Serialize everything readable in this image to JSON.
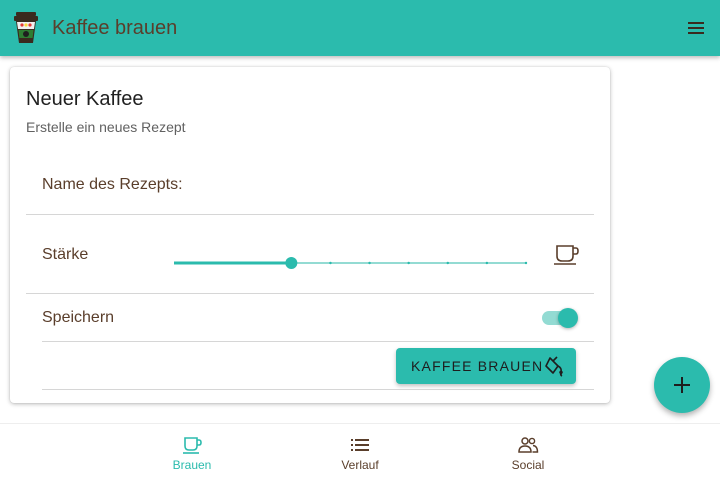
{
  "header": {
    "title": "Kaffee brauen",
    "logo_icon": "coffee-cup-logo-icon",
    "menu_icon": "menu-icon"
  },
  "card": {
    "title": "Neuer Kaffee",
    "subtitle": "Erstelle ein neues Rezept",
    "name_field": {
      "label": "Name des Rezepts:",
      "value": ""
    },
    "strength": {
      "label": "Stärke",
      "value": 4,
      "min": 1,
      "max": 10,
      "icon": "coffee-cup-icon"
    },
    "save": {
      "label": "Speichern",
      "enabled": true
    },
    "brew_button": {
      "label": "KAFFEE BRAUEN",
      "icon": "coffee-pour-icon"
    }
  },
  "fab": {
    "icon": "add-icon"
  },
  "bottom_nav": {
    "items": [
      {
        "label": "Brauen",
        "icon": "coffee-cup-icon",
        "active": true
      },
      {
        "label": "Verlauf",
        "icon": "list-icon",
        "active": false
      },
      {
        "label": "Social",
        "icon": "people-icon",
        "active": false
      }
    ]
  },
  "colors": {
    "primary": "#2bbbad",
    "primary_light": "#93dbd3",
    "text_brown": "#5a3e2b",
    "inactive_nav": "#5a3e2b"
  }
}
